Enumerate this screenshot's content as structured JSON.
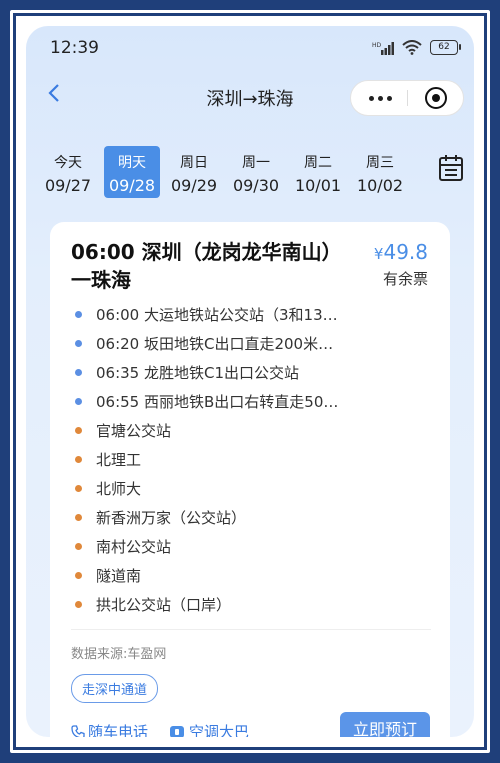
{
  "status_bar": {
    "time": "12:39",
    "battery": "62"
  },
  "nav": {
    "title": "深圳→珠海"
  },
  "dates": [
    {
      "day": "今天",
      "date": "09/27",
      "active": false
    },
    {
      "day": "明天",
      "date": "09/28",
      "active": true
    },
    {
      "day": "周日",
      "date": "09/29",
      "active": false
    },
    {
      "day": "周一",
      "date": "09/30",
      "active": false
    },
    {
      "day": "周二",
      "date": "10/01",
      "active": false
    },
    {
      "day": "周三",
      "date": "10/02",
      "active": false
    }
  ],
  "trip": {
    "title": "06:00 深圳（龙岗龙华南山）一珠海",
    "price_symbol": "¥",
    "price": "49.8",
    "availability": "有余票",
    "stops": [
      {
        "text": "06:00 大运地铁站公交站（3和13…",
        "type": "boarding"
      },
      {
        "text": "06:20 坂田地铁C出口直走200米…",
        "type": "boarding"
      },
      {
        "text": "06:35 龙胜地铁C1出口公交站",
        "type": "boarding"
      },
      {
        "text": "06:55 西丽地铁B出口右转直走50…",
        "type": "boarding"
      },
      {
        "text": "官塘公交站",
        "type": "alighting"
      },
      {
        "text": "北理工",
        "type": "alighting"
      },
      {
        "text": "北师大",
        "type": "alighting"
      },
      {
        "text": "新香洲万家（公交站）",
        "type": "alighting"
      },
      {
        "text": "南村公交站",
        "type": "alighting"
      },
      {
        "text": "隧道南",
        "type": "alighting"
      },
      {
        "text": "拱北公交站（口岸）",
        "type": "alighting"
      }
    ],
    "source": "数据来源:车盈网",
    "tag": "走深中通道",
    "features": [
      "随车电话",
      "空调大巴"
    ],
    "book_label": "立即预订"
  },
  "colors": {
    "accent": "#4a8ee6",
    "boarding_dot": "#5b8fe3",
    "alighting_dot": "#e0883a"
  },
  "icons": [
    "signal-icon",
    "wifi-icon",
    "battery-icon",
    "back-icon",
    "more-icon",
    "target-icon",
    "calendar-icon",
    "phone-icon",
    "bus-icon"
  ]
}
